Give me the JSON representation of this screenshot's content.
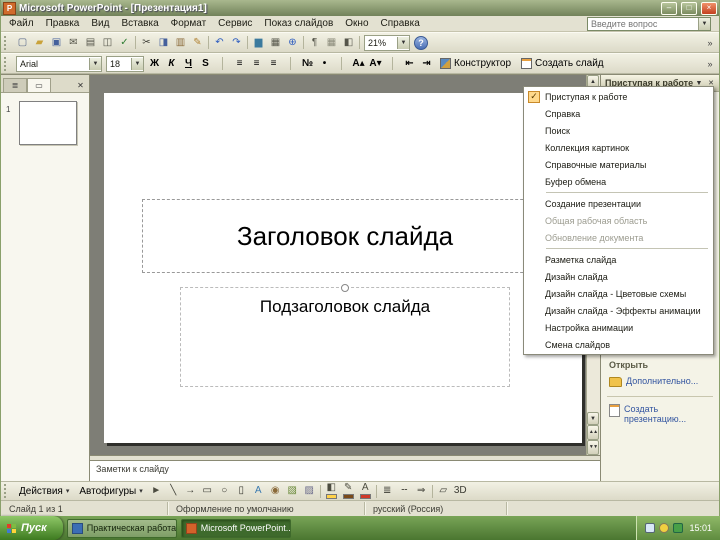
{
  "window": {
    "title": "Microsoft PowerPoint - [Презентация1]",
    "controls": [
      {
        "name": "minimize-button",
        "glyph": "–"
      },
      {
        "name": "maximize-button",
        "glyph": "□"
      },
      {
        "name": "close-button",
        "glyph": "×",
        "variant": "close"
      }
    ]
  },
  "menu_bar": {
    "items": [
      {
        "name": "menu-file",
        "label": "Файл"
      },
      {
        "name": "menu-edit",
        "label": "Правка"
      },
      {
        "name": "menu-view",
        "label": "Вид"
      },
      {
        "name": "menu-insert",
        "label": "Вставка"
      },
      {
        "name": "menu-format",
        "label": "Формат"
      },
      {
        "name": "menu-tools",
        "label": "Сервис"
      },
      {
        "name": "menu-slideshow",
        "label": "Показ слайдов"
      },
      {
        "name": "menu-window",
        "label": "Окно"
      },
      {
        "name": "menu-help",
        "label": "Справка"
      }
    ],
    "question_placeholder": "Введите вопрос"
  },
  "standard_toolbar": {
    "zoom_value": "21%",
    "help_glyph": "?",
    "icons": [
      {
        "name": "new-file-icon",
        "glyph": "▢",
        "color": "#5a6a8c"
      },
      {
        "name": "open-folder-icon",
        "glyph": "▰",
        "color": "#c9a23a"
      },
      {
        "name": "save-icon",
        "glyph": "▣",
        "color": "#44609c"
      },
      {
        "name": "email-icon",
        "glyph": "✉",
        "color": "#55554a"
      },
      {
        "name": "print-icon",
        "glyph": "▤",
        "color": "#55554a"
      },
      {
        "name": "print-preview-icon",
        "glyph": "◫",
        "color": "#55554a"
      },
      {
        "name": "spelling-icon",
        "glyph": "✓",
        "color": "#2e7d32"
      },
      {
        "separator": true
      },
      {
        "name": "cut-icon",
        "glyph": "✂",
        "color": "#3c3c34"
      },
      {
        "name": "copy-icon",
        "glyph": "◨",
        "color": "#44609c"
      },
      {
        "name": "paste-icon",
        "glyph": "▥",
        "color": "#8a6a3a"
      },
      {
        "name": "format-painter-icon",
        "glyph": "✎",
        "color": "#b08030"
      },
      {
        "separator": true
      },
      {
        "name": "undo-icon",
        "glyph": "↶",
        "color": "#2b5bbf"
      },
      {
        "name": "redo-icon",
        "glyph": "↷",
        "color": "#2b5bbf"
      },
      {
        "separator": true
      },
      {
        "name": "insert-chart-icon",
        "glyph": "▆",
        "color": "#3b7a9e"
      },
      {
        "name": "insert-table-icon",
        "glyph": "▦",
        "color": "#55554a"
      },
      {
        "name": "insert-hyperlink-icon",
        "glyph": "⊕",
        "color": "#2b5bbf"
      },
      {
        "separator": true
      },
      {
        "name": "show-formatting-icon",
        "glyph": "¶",
        "color": "#55554a"
      },
      {
        "name": "grid-icon",
        "glyph": "▦",
        "color": "#8a8a7a"
      },
      {
        "name": "color-grayscale-icon",
        "glyph": "◧",
        "color": "#55554a"
      },
      {
        "separator": true
      }
    ]
  },
  "formatting_toolbar": {
    "font_name": "Arial",
    "font_size": "18",
    "design_label": "Конструктор",
    "new_slide_label": "Создать слайд",
    "buttons": [
      {
        "name": "bold-button",
        "glyph": "Ж"
      },
      {
        "name": "italic-button",
        "glyph": "К",
        "style": "italic"
      },
      {
        "name": "underline-button",
        "glyph": "Ч",
        "style": "underline"
      },
      {
        "name": "text-shadow-button",
        "glyph": "S"
      },
      {
        "separator": true
      },
      {
        "name": "align-left-button",
        "glyph": "≡"
      },
      {
        "name": "align-center-button",
        "glyph": "≡"
      },
      {
        "name": "align-right-button",
        "glyph": "≡"
      },
      {
        "separator": true
      },
      {
        "name": "numbering-button",
        "glyph": "№"
      },
      {
        "name": "bullets-button",
        "glyph": "•"
      },
      {
        "separator": true
      },
      {
        "name": "increase-font-button",
        "glyph": "A▴"
      },
      {
        "name": "decrease-font-button",
        "glyph": "A▾"
      },
      {
        "separator": true
      },
      {
        "name": "decrease-indent-button",
        "glyph": "⇤"
      },
      {
        "name": "increase-indent-button",
        "glyph": "⇥"
      }
    ]
  },
  "left_pane": {
    "slide_number": "1",
    "tabs": [
      {
        "name": "outline-tab",
        "glyph": "≣"
      },
      {
        "name": "slides-tab",
        "glyph": "▭",
        "selected": true
      }
    ]
  },
  "slide": {
    "title": "Заголовок слайда",
    "subtitle": "Подзаголовок слайда"
  },
  "notes": {
    "placeholder": "Заметки к слайду"
  },
  "task_pane": {
    "title": "Приступая к работе",
    "open_heading": "Открыть",
    "more_link": "Дополнительно...",
    "create_link": "Создать презентацию...",
    "menu": [
      {
        "label": "Приступая к работе",
        "checked": true
      },
      {
        "label": "Справка"
      },
      {
        "label": "Поиск"
      },
      {
        "label": "Коллекция картинок"
      },
      {
        "label": "Справочные материалы"
      },
      {
        "label": "Буфер обмена"
      },
      {
        "separator": true
      },
      {
        "label": "Создание презентации"
      },
      {
        "label": "Общая рабочая область",
        "disabled": true
      },
      {
        "label": "Обновление документа",
        "disabled": true
      },
      {
        "separator": true
      },
      {
        "label": "Разметка слайда"
      },
      {
        "label": "Дизайн слайда"
      },
      {
        "label": "Дизайн слайда - Цветовые схемы"
      },
      {
        "label": "Дизайн слайда - Эффекты анимации"
      },
      {
        "label": "Настройка анимации"
      },
      {
        "label": "Смена слайдов"
      }
    ]
  },
  "drawing_toolbar": {
    "actions_label": "Действия",
    "autoshapes_label": "Автофигуры",
    "icons": [
      {
        "name": "select-arrow-icon",
        "glyph": "►",
        "color": "#4c4c40"
      },
      {
        "name": "line-icon",
        "glyph": "╲",
        "color": "#3c3c34"
      },
      {
        "name": "arrow-icon",
        "glyph": "→",
        "color": "#3c3c34"
      },
      {
        "name": "rectangle-icon",
        "glyph": "▭",
        "color": "#3c3c34"
      },
      {
        "name": "oval-icon",
        "glyph": "○",
        "color": "#3c3c34"
      },
      {
        "name": "text-box-icon",
        "glyph": "▯",
        "color": "#3c3c34"
      },
      {
        "name": "wordart-icon",
        "glyph": "A",
        "color": "#3a7ab0"
      },
      {
        "name": "diagram-icon",
        "glyph": "◉",
        "color": "#8a6a3a"
      },
      {
        "name": "clipart-icon",
        "glyph": "▧",
        "color": "#6a8a3a"
      },
      {
        "name": "picture-icon",
        "glyph": "▨",
        "color": "#6a6a8a"
      },
      {
        "separator": true
      },
      {
        "name": "fill-color-icon",
        "glyph": "◧",
        "bar": "#ffd24a",
        "color": "#4c4c40"
      },
      {
        "name": "line-color-icon",
        "glyph": "✎",
        "bar": "#7a4a1a",
        "color": "#4c4c40"
      },
      {
        "name": "font-color-icon",
        "glyph": "А",
        "bar": "#d03a2a",
        "color": "#4c4c40"
      },
      {
        "separator": true
      },
      {
        "name": "line-style-icon",
        "glyph": "≣",
        "color": "#3c3c34"
      },
      {
        "name": "dash-style-icon",
        "glyph": "╌",
        "color": "#3c3c34"
      },
      {
        "name": "arrow-style-icon",
        "glyph": "⇒",
        "color": "#3c3c34"
      },
      {
        "separator": true
      },
      {
        "name": "shadow-style-icon",
        "glyph": "▱",
        "color": "#3c3c34"
      },
      {
        "name": "threed-style-icon",
        "glyph": "3D",
        "color": "#3c3c34"
      }
    ]
  },
  "status_bar": {
    "slide": "Слайд 1 из 1",
    "design": "Оформление по умолчанию",
    "language": "русский (Россия)"
  },
  "taskbar": {
    "start_label": "Пуск",
    "buttons": [
      {
        "label": "Практическая работа",
        "icon_color": "#3b6eb5"
      },
      {
        "label": "Microsoft PowerPoint...",
        "icon_color": "#d4622a",
        "active": true
      }
    ],
    "time": "15:01"
  }
}
